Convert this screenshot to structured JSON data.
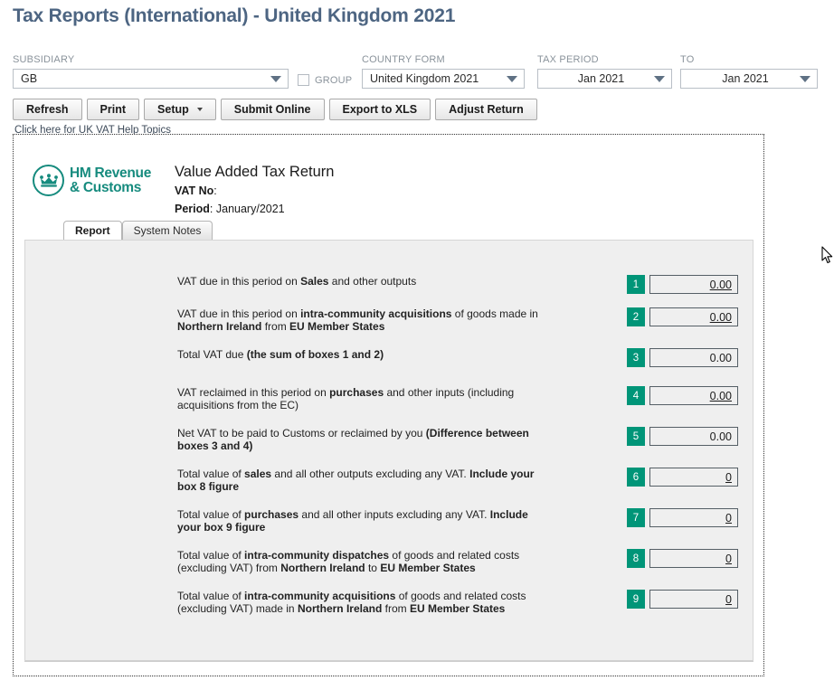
{
  "page": {
    "title": "Tax Reports (International) - United Kingdom 2021",
    "title_color": "#4d6582"
  },
  "filters": {
    "subsidiary": {
      "label": "SUBSIDIARY",
      "value": "GB",
      "caret_icon": "chevron-down-icon"
    },
    "group": {
      "label": "GROUP",
      "checked": false
    },
    "country_form": {
      "label": "COUNTRY FORM",
      "value": "United Kingdom 2021",
      "caret_icon": "chevron-down-icon"
    },
    "tax_period": {
      "label": "TAX PERIOD",
      "value": "Jan 2021",
      "caret_icon": "chevron-down-icon"
    },
    "to": {
      "label": "TO",
      "value": "Jan 2021",
      "caret_icon": "chevron-down-icon"
    }
  },
  "toolbar": {
    "refresh_label": "Refresh",
    "print_label": "Print",
    "setup_label": "Setup",
    "setup_caret_icon": "caret-down-icon",
    "submit_online_label": "Submit Online",
    "export_xls_label": "Export to XLS",
    "adjust_return_label": "Adjust Return"
  },
  "help_link": {
    "label": "Click here for UK VAT Help Topics"
  },
  "report": {
    "logo": {
      "icon": "hmrc-crown-icon",
      "line1": "HM Revenue",
      "line2": "& Customs",
      "color": "#168b7e"
    },
    "title": "Value Added Tax Return",
    "vat_no_label": "VAT No",
    "vat_no_value": "",
    "period_label": "Period",
    "period_value": "January/2021",
    "tabs": [
      {
        "label": "Report",
        "active": true
      },
      {
        "label": "System Notes",
        "active": false
      }
    ],
    "box_badge_color": "#009578",
    "rows": [
      {
        "number": "1",
        "value": "0.00",
        "linked": true,
        "parts": [
          {
            "text": "VAT due in this period on ",
            "bold": false
          },
          {
            "text": "Sales",
            "bold": true
          },
          {
            "text": " and other outputs",
            "bold": false
          }
        ]
      },
      {
        "number": "2",
        "value": "0.00",
        "linked": true,
        "parts": [
          {
            "text": "VAT due in this period on ",
            "bold": false
          },
          {
            "text": "intra-community acquisitions",
            "bold": true
          },
          {
            "text": " of goods made in ",
            "bold": false
          },
          {
            "text": "Northern Ireland",
            "bold": true
          },
          {
            "text": " from ",
            "bold": false
          },
          {
            "text": "EU Member States",
            "bold": true
          }
        ]
      },
      {
        "number": "3",
        "value": "0.00",
        "linked": false,
        "parts": [
          {
            "text": "Total VAT due ",
            "bold": false
          },
          {
            "text": "(the sum of boxes 1 and 2)",
            "bold": true
          }
        ]
      },
      {
        "number": "4",
        "value": "0.00",
        "linked": true,
        "parts": [
          {
            "text": "VAT reclaimed in this period on ",
            "bold": false
          },
          {
            "text": "purchases",
            "bold": true
          },
          {
            "text": " and other inputs (including acquisitions from the EC)",
            "bold": false
          }
        ]
      },
      {
        "number": "5",
        "value": "0.00",
        "linked": false,
        "parts": [
          {
            "text": "Net VAT to be paid to Customs or reclaimed by you ",
            "bold": false
          },
          {
            "text": "(Difference between boxes 3 and 4)",
            "bold": true
          }
        ]
      },
      {
        "number": "6",
        "value": "0",
        "linked": true,
        "parts": [
          {
            "text": "Total value of ",
            "bold": false
          },
          {
            "text": "sales",
            "bold": true
          },
          {
            "text": " and all other outputs excluding any VAT. ",
            "bold": false
          },
          {
            "text": "Include your box 8 figure",
            "bold": true
          }
        ]
      },
      {
        "number": "7",
        "value": "0",
        "linked": true,
        "parts": [
          {
            "text": "Total value of ",
            "bold": false
          },
          {
            "text": "purchases",
            "bold": true
          },
          {
            "text": " and all other inputs excluding any VAT. ",
            "bold": false
          },
          {
            "text": "Include your box 9 figure",
            "bold": true
          }
        ]
      },
      {
        "number": "8",
        "value": "0",
        "linked": true,
        "parts": [
          {
            "text": "Total value of ",
            "bold": false
          },
          {
            "text": "intra-community dispatches",
            "bold": true
          },
          {
            "text": " of goods and related costs (excluding VAT) from ",
            "bold": false
          },
          {
            "text": "Northern Ireland",
            "bold": true
          },
          {
            "text": " to ",
            "bold": false
          },
          {
            "text": "EU Member States",
            "bold": true
          }
        ]
      },
      {
        "number": "9",
        "value": "0",
        "linked": true,
        "parts": [
          {
            "text": "Total value of ",
            "bold": false
          },
          {
            "text": "intra-community acquisitions",
            "bold": true
          },
          {
            "text": " of goods and related costs (excluding VAT) made in ",
            "bold": false
          },
          {
            "text": "Northern Ireland",
            "bold": true
          },
          {
            "text": " from ",
            "bold": false
          },
          {
            "text": "EU Member States",
            "bold": true
          }
        ]
      }
    ]
  }
}
